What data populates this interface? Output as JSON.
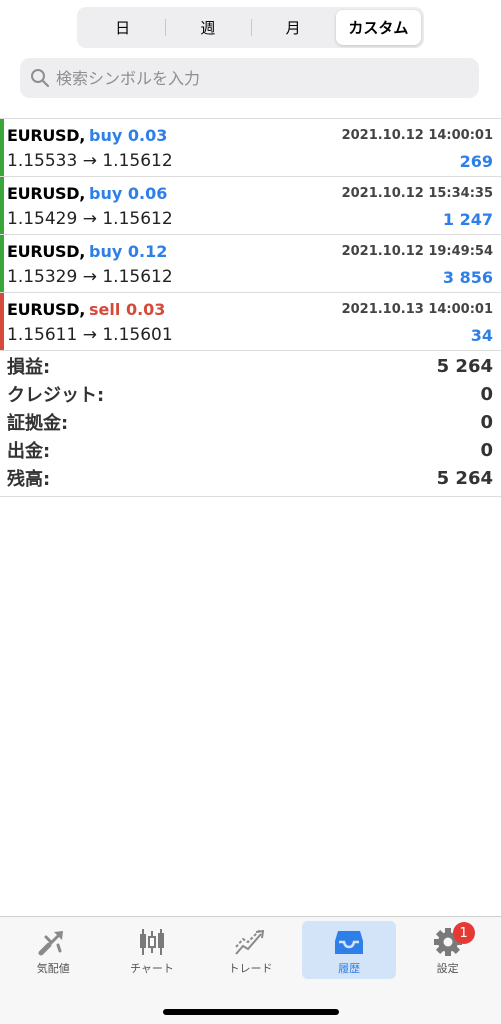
{
  "segments": [
    "日",
    "週",
    "月",
    "カスタム"
  ],
  "search": {
    "placeholder": "検索シンボルを入力"
  },
  "trades": [
    {
      "symbol": "EURUSD,",
      "side": "buy",
      "side_label": "buy 0.03",
      "time": "2021.10.12 14:00:01",
      "prices": "1.15533 → 1.15612",
      "profit": "269",
      "bar_color": "#3aa63a"
    },
    {
      "symbol": "EURUSD,",
      "side": "buy",
      "side_label": "buy 0.06",
      "time": "2021.10.12 15:34:35",
      "prices": "1.15429 → 1.15612",
      "profit": "1 247",
      "bar_color": "#3aa63a"
    },
    {
      "symbol": "EURUSD,",
      "side": "buy",
      "side_label": "buy 0.12",
      "time": "2021.10.12 19:49:54",
      "prices": "1.15329 → 1.15612",
      "profit": "3 856",
      "bar_color": "#3aa63a"
    },
    {
      "symbol": "EURUSD,",
      "side": "sell",
      "side_label": "sell 0.03",
      "time": "2021.10.13 14:00:01",
      "prices": "1.15611 → 1.15601",
      "profit": "34",
      "bar_color": "#d64a3a"
    }
  ],
  "summary": [
    {
      "label": "損益:",
      "value": "5 264"
    },
    {
      "label": "クレジット:",
      "value": "0"
    },
    {
      "label": "証拠金:",
      "value": "0"
    },
    {
      "label": "出金:",
      "value": "0"
    },
    {
      "label": "残高:",
      "value": "5 264"
    }
  ],
  "tabbar": {
    "items": [
      {
        "label": "気配値",
        "icon": "quotes-icon"
      },
      {
        "label": "チャート",
        "icon": "chart-icon"
      },
      {
        "label": "トレード",
        "icon": "trade-icon"
      },
      {
        "label": "履歴",
        "icon": "history-icon"
      },
      {
        "label": "設定",
        "icon": "settings-icon"
      }
    ],
    "badge": "1",
    "active_color": "#2e7fe8"
  }
}
